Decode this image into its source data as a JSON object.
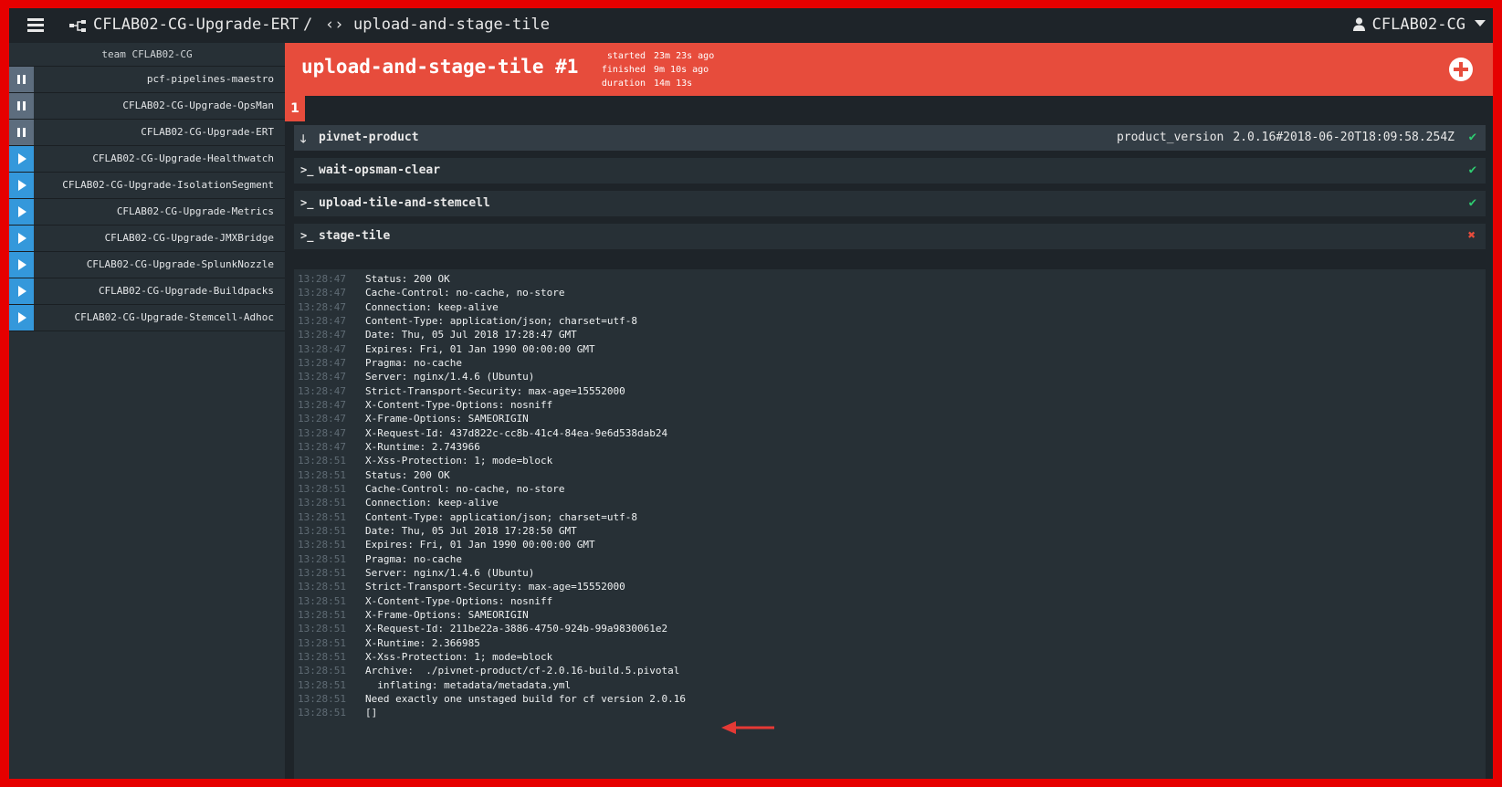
{
  "topbar": {
    "pipeline": "CFLAB02-CG-Upgrade-ERT",
    "separator": "/",
    "job": "upload-and-stage-tile",
    "user": "CFLAB02-CG"
  },
  "sidebar": {
    "team_label": "team CFLAB02-CG",
    "pipelines": [
      {
        "name": "pcf-pipelines-maestro",
        "state": "paused"
      },
      {
        "name": "CFLAB02-CG-Upgrade-OpsMan",
        "state": "paused"
      },
      {
        "name": "CFLAB02-CG-Upgrade-ERT",
        "state": "paused"
      },
      {
        "name": "CFLAB02-CG-Upgrade-Healthwatch",
        "state": "active"
      },
      {
        "name": "CFLAB02-CG-Upgrade-IsolationSegment",
        "state": "active"
      },
      {
        "name": "CFLAB02-CG-Upgrade-Metrics",
        "state": "active"
      },
      {
        "name": "CFLAB02-CG-Upgrade-JMXBridge",
        "state": "active"
      },
      {
        "name": "CFLAB02-CG-Upgrade-SplunkNozzle",
        "state": "active"
      },
      {
        "name": "CFLAB02-CG-Upgrade-Buildpacks",
        "state": "active"
      },
      {
        "name": "CFLAB02-CG-Upgrade-Stemcell-Adhoc",
        "state": "active"
      }
    ]
  },
  "build": {
    "title": "upload-and-stage-tile #1",
    "started_label": "started",
    "started": "23m 23s ago",
    "finished_label": "finished",
    "finished": "9m 10s ago",
    "duration_label": "duration",
    "duration": "14m 13s",
    "tab": "1",
    "status_color": "#e74c3c"
  },
  "steps": [
    {
      "name": "pivnet-product",
      "icon": "arrow-down-icon",
      "version_key": "product_version",
      "version_value": "2.0.16#2018-06-20T18:09:58.254Z",
      "status": "succeeded"
    },
    {
      "name": "wait-opsman-clear",
      "icon": "terminal-icon",
      "status": "succeeded"
    },
    {
      "name": "upload-tile-and-stemcell",
      "icon": "terminal-icon",
      "status": "succeeded"
    },
    {
      "name": "stage-tile",
      "icon": "terminal-icon",
      "status": "failed"
    }
  ],
  "log": [
    {
      "t": "13:28:47",
      "m": "Status: 200 OK"
    },
    {
      "t": "13:28:47",
      "m": "Cache-Control: no-cache, no-store"
    },
    {
      "t": "13:28:47",
      "m": "Connection: keep-alive"
    },
    {
      "t": "13:28:47",
      "m": "Content-Type: application/json; charset=utf-8"
    },
    {
      "t": "13:28:47",
      "m": "Date: Thu, 05 Jul 2018 17:28:47 GMT"
    },
    {
      "t": "13:28:47",
      "m": "Expires: Fri, 01 Jan 1990 00:00:00 GMT"
    },
    {
      "t": "13:28:47",
      "m": "Pragma: no-cache"
    },
    {
      "t": "13:28:47",
      "m": "Server: nginx/1.4.6 (Ubuntu)"
    },
    {
      "t": "13:28:47",
      "m": "Strict-Transport-Security: max-age=15552000"
    },
    {
      "t": "13:28:47",
      "m": "X-Content-Type-Options: nosniff"
    },
    {
      "t": "13:28:47",
      "m": "X-Frame-Options: SAMEORIGIN"
    },
    {
      "t": "13:28:47",
      "m": "X-Request-Id: 437d822c-cc8b-41c4-84ea-9e6d538dab24"
    },
    {
      "t": "13:28:47",
      "m": "X-Runtime: 2.743966"
    },
    {
      "t": "13:28:51",
      "m": "X-Xss-Protection: 1; mode=block"
    },
    {
      "t": "13:28:51",
      "m": "Status: 200 OK"
    },
    {
      "t": "13:28:51",
      "m": "Cache-Control: no-cache, no-store"
    },
    {
      "t": "13:28:51",
      "m": "Connection: keep-alive"
    },
    {
      "t": "13:28:51",
      "m": "Content-Type: application/json; charset=utf-8"
    },
    {
      "t": "13:28:51",
      "m": "Date: Thu, 05 Jul 2018 17:28:50 GMT"
    },
    {
      "t": "13:28:51",
      "m": "Expires: Fri, 01 Jan 1990 00:00:00 GMT"
    },
    {
      "t": "13:28:51",
      "m": "Pragma: no-cache"
    },
    {
      "t": "13:28:51",
      "m": "Server: nginx/1.4.6 (Ubuntu)"
    },
    {
      "t": "13:28:51",
      "m": "Strict-Transport-Security: max-age=15552000"
    },
    {
      "t": "13:28:51",
      "m": "X-Content-Type-Options: nosniff"
    },
    {
      "t": "13:28:51",
      "m": "X-Frame-Options: SAMEORIGIN"
    },
    {
      "t": "13:28:51",
      "m": "X-Request-Id: 211be22a-3886-4750-924b-99a9830061e2"
    },
    {
      "t": "13:28:51",
      "m": "X-Runtime: 2.366985"
    },
    {
      "t": "13:28:51",
      "m": "X-Xss-Protection: 1; mode=block"
    },
    {
      "t": "13:28:51",
      "m": "Archive:  ./pivnet-product/cf-2.0.16-build.5.pivotal"
    },
    {
      "t": "13:28:51",
      "m": "  inflating: metadata/metadata.yml"
    },
    {
      "t": "13:28:51",
      "m": "Need exactly one unstaged build for cf version 2.0.16"
    },
    {
      "t": "13:28:51",
      "m": "[]"
    }
  ],
  "annotation": {
    "icon": "red-arrow-icon",
    "color": "#e53935"
  }
}
